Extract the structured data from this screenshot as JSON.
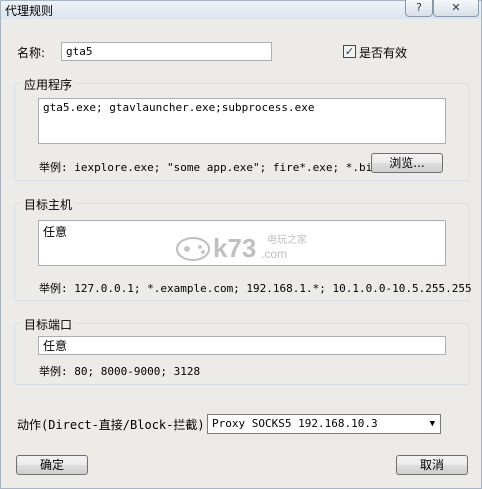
{
  "window": {
    "title": "代理规则",
    "help_label": "?",
    "close_label": "✕"
  },
  "name": {
    "label": "名称:",
    "value": "gta5"
  },
  "enabled": {
    "label": "是否有效",
    "checked": true,
    "checkmark": "✓"
  },
  "applications": {
    "group_title": "应用程序",
    "value": "gta5.exe; gtavlauncher.exe;subprocess.exe",
    "example": "举例: iexplore.exe; \"some app.exe\"; fire*.exe; *.bin",
    "browse_label": "浏览..."
  },
  "target_host": {
    "group_title": "目标主机",
    "value": "任意",
    "example": "举例: 127.0.0.1; *.example.com; 192.168.1.*; 10.1.0.0-10.5.255.255"
  },
  "target_port": {
    "group_title": "目标端口",
    "value": "任意",
    "example": "举例: 80; 8000-9000; 3128"
  },
  "action": {
    "label": "动作(Direct-直接/Block-拦截):",
    "selected": "Proxy SOCKS5 192.168.10.3"
  },
  "buttons": {
    "ok": "确定",
    "cancel": "取消"
  },
  "watermark": {
    "brand": "k73",
    "sub": "电玩之家",
    "domain": ".com"
  }
}
